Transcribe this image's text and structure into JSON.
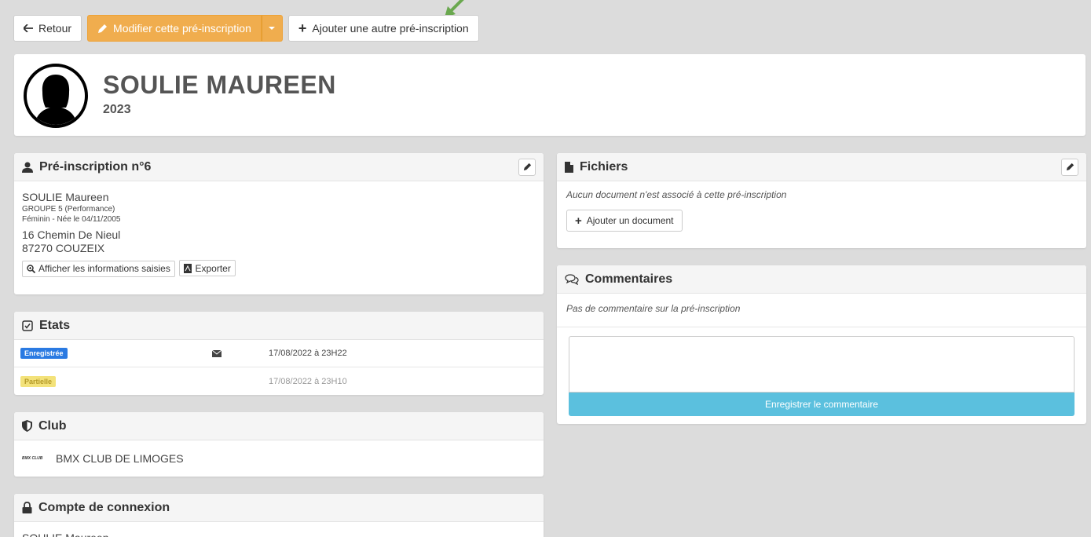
{
  "toolbar": {
    "back_label": "Retour",
    "edit_label": "Modifier cette pré-inscription",
    "add_label": "Ajouter une autre pré-inscription"
  },
  "profile": {
    "name": "SOULIE MAUREEN",
    "year": "2023"
  },
  "preinscription": {
    "title": "Pré-inscription n°6",
    "name": "SOULIE Maureen",
    "group": "GROUPE 5 (Performance)",
    "gender_birth": "Féminin - Née le 04/11/2005",
    "address_line1": "16 Chemin De Nieul",
    "address_line2": "87270 COUZEIX",
    "show_info_label": "Afficher les informations saisies",
    "export_label": "Exporter"
  },
  "etats": {
    "title": "Etats",
    "rows": [
      {
        "status": "Enregistrée",
        "date": "17/08/2022 à 23H22",
        "color": "#2a7ae2"
      },
      {
        "status": "Partielle",
        "date": "17/08/2022 à 23H10",
        "color": "#f3e27a"
      }
    ]
  },
  "club": {
    "title": "Club",
    "name": "BMX CLUB DE LIMOGES",
    "logo_text": "BMX CLUB"
  },
  "compte": {
    "title": "Compte de connexion",
    "name": "SOULIE Maureen"
  },
  "fichiers": {
    "title": "Fichiers",
    "empty_text": "Aucun document n'est associé à cette pré-inscription",
    "add_label": "Ajouter un document"
  },
  "commentaires": {
    "title": "Commentaires",
    "empty_text": "Pas de commentaire sur la pré-inscription",
    "submit_label": "Enregistrer le commentaire"
  },
  "colors": {
    "warning": "#f0ad4e",
    "info": "#5bc0de",
    "arrow": "#6aa84f"
  }
}
